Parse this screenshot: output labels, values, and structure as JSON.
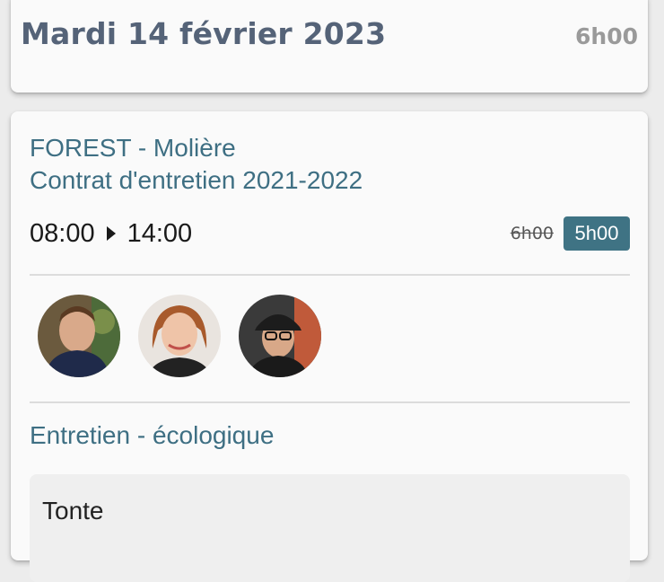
{
  "day": {
    "title": "Mardi 14 février 2023",
    "total": "6h00"
  },
  "job": {
    "client": "FOREST - Molière",
    "contract": "Contrat d'entretien 2021-2022",
    "start_time": "08:00",
    "end_time": "14:00",
    "planned_duration": "6h00",
    "actual_duration": "5h00",
    "workers": [
      {
        "avatar": "avatar-photo"
      },
      {
        "avatar": "avatar-photo"
      },
      {
        "avatar": "avatar-photo"
      }
    ],
    "service": "Entretien - écologique",
    "tasks": [
      {
        "label": "Tonte"
      }
    ]
  },
  "colors": {
    "accent": "#3e6f83",
    "badge": "#3f7384",
    "title": "#556378",
    "muted": "#9a9a9a"
  }
}
